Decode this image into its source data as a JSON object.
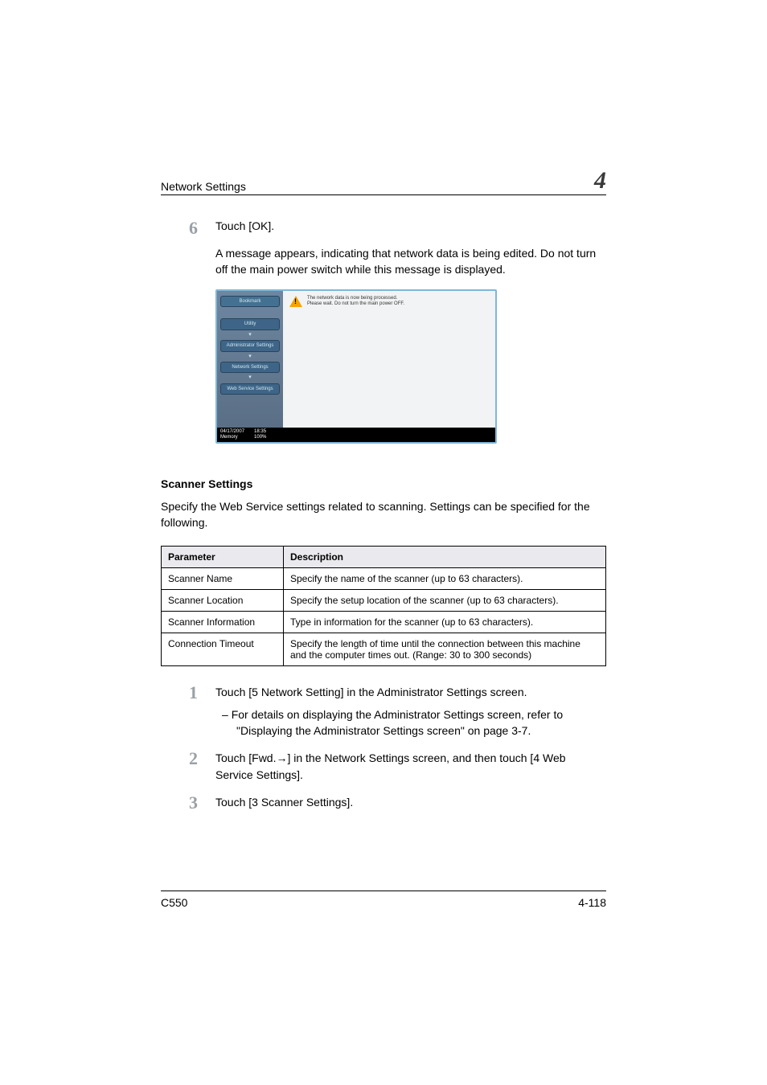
{
  "header": {
    "section": "Network Settings",
    "chapter": "4"
  },
  "step6": {
    "num": "6",
    "line1": "Touch [OK].",
    "line2": "A message appears, indicating that network data is being edited. Do not turn off the main power switch while this message is displayed."
  },
  "screenshot": {
    "sidebar": {
      "bookmark": "Bookmark",
      "utility": "Utility",
      "admin": "Administrator Settings",
      "network": "Network Settings",
      "web": "Web Service Settings"
    },
    "warning_l1": "The network data is now being processed.",
    "warning_l2": "Please wait. Do not turn the main power OFF.",
    "status": {
      "date": "04/17/2007",
      "time": "18:35",
      "mem_label": "Memory",
      "mem_val": "100%"
    }
  },
  "scanner_section": {
    "title": "Scanner Settings",
    "intro": "Specify the Web Service settings related to scanning. Settings can be specified for the following."
  },
  "table": {
    "h1": "Parameter",
    "h2": "Description",
    "rows": [
      {
        "p": "Scanner Name",
        "d": "Specify the name of the scanner (up to 63 characters)."
      },
      {
        "p": "Scanner Location",
        "d": "Specify the setup location of the scanner (up to 63 characters)."
      },
      {
        "p": "Scanner Information",
        "d": "Type in information for the scanner (up to 63 characters)."
      },
      {
        "p": "Connection Timeout",
        "d": "Specify the length of time until the connection between this machine and the computer times out. (Range: 30 to 300 seconds)"
      }
    ]
  },
  "steps": {
    "s1": {
      "num": "1",
      "text": "Touch [5 Network Setting] in the Administrator Settings screen.",
      "sub": "For details on displaying the Administrator Settings screen, refer to \"Displaying the Administrator Settings screen\" on page 3-7."
    },
    "s2": {
      "num": "2",
      "text": "Touch [Fwd.→] in the Network Settings screen, and then touch [4 Web Service Settings]."
    },
    "s3": {
      "num": "3",
      "text": "Touch [3 Scanner Settings]."
    }
  },
  "footer": {
    "model": "C550",
    "page": "4-118"
  }
}
